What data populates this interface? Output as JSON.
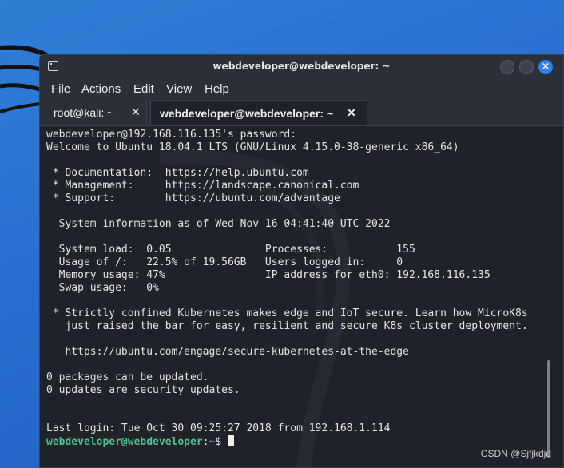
{
  "window": {
    "title": "webdeveloper@webdeveloper: ~"
  },
  "menu": [
    "File",
    "Actions",
    "Edit",
    "View",
    "Help"
  ],
  "tabs": [
    {
      "label": "root@kali: ~",
      "close": "✕",
      "active": false
    },
    {
      "label": "webdeveloper@webdeveloper: ~",
      "close": "✕",
      "active": true
    }
  ],
  "terminal": {
    "lines": [
      "webdeveloper@192.168.116.135's password:",
      "Welcome to Ubuntu 18.04.1 LTS (GNU/Linux 4.15.0-38-generic x86_64)",
      "",
      " * Documentation:  https://help.ubuntu.com",
      " * Management:     https://landscape.canonical.com",
      " * Support:        https://ubuntu.com/advantage",
      "",
      "  System information as of Wed Nov 16 04:41:40 UTC 2022",
      "",
      "  System load:  0.05               Processes:           155",
      "  Usage of /:   22.5% of 19.56GB   Users logged in:     0",
      "  Memory usage: 47%                IP address for eth0: 192.168.116.135",
      "  Swap usage:   0%",
      "",
      " * Strictly confined Kubernetes makes edge and IoT secure. Learn how MicroK8s",
      "   just raised the bar for easy, resilient and secure K8s cluster deployment.",
      "",
      "   https://ubuntu.com/engage/secure-kubernetes-at-the-edge",
      "",
      "0 packages can be updated.",
      "0 updates are security updates.",
      "",
      "",
      "Last login: Tue Oct 30 09:25:27 2018 from 192.168.1.114"
    ],
    "prompt_user": "webdeveloper@webdeveloper",
    "prompt_sep": ":",
    "prompt_path": "~",
    "prompt_symbol": "$ "
  },
  "watermark": "CSDN @Sjfjkdjd"
}
